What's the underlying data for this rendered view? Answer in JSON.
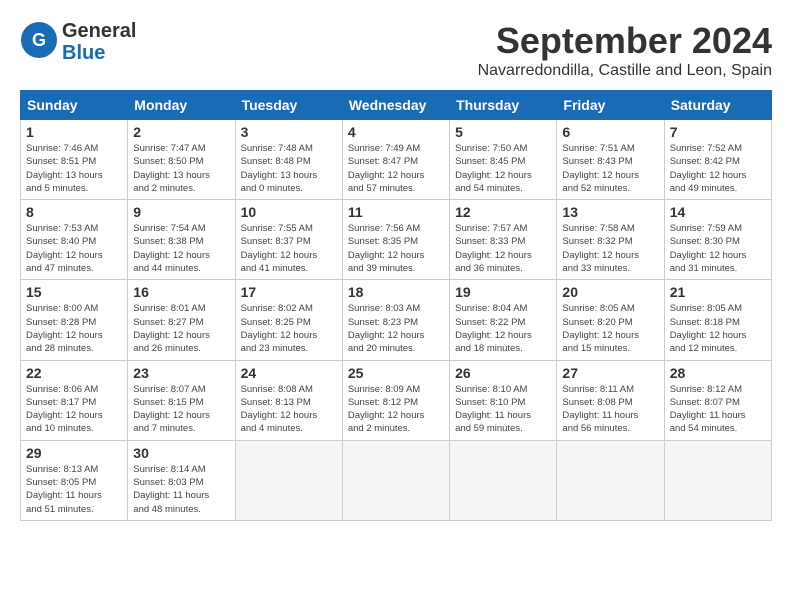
{
  "header": {
    "logo_line1": "General",
    "logo_line2": "Blue",
    "month": "September 2024",
    "location": "Navarredondilla, Castille and Leon, Spain"
  },
  "weekdays": [
    "Sunday",
    "Monday",
    "Tuesday",
    "Wednesday",
    "Thursday",
    "Friday",
    "Saturday"
  ],
  "weeks": [
    [
      {
        "day": "1",
        "info": "Sunrise: 7:46 AM\nSunset: 8:51 PM\nDaylight: 13 hours\nand 5 minutes."
      },
      {
        "day": "2",
        "info": "Sunrise: 7:47 AM\nSunset: 8:50 PM\nDaylight: 13 hours\nand 2 minutes."
      },
      {
        "day": "3",
        "info": "Sunrise: 7:48 AM\nSunset: 8:48 PM\nDaylight: 13 hours\nand 0 minutes."
      },
      {
        "day": "4",
        "info": "Sunrise: 7:49 AM\nSunset: 8:47 PM\nDaylight: 12 hours\nand 57 minutes."
      },
      {
        "day": "5",
        "info": "Sunrise: 7:50 AM\nSunset: 8:45 PM\nDaylight: 12 hours\nand 54 minutes."
      },
      {
        "day": "6",
        "info": "Sunrise: 7:51 AM\nSunset: 8:43 PM\nDaylight: 12 hours\nand 52 minutes."
      },
      {
        "day": "7",
        "info": "Sunrise: 7:52 AM\nSunset: 8:42 PM\nDaylight: 12 hours\nand 49 minutes."
      }
    ],
    [
      {
        "day": "8",
        "info": "Sunrise: 7:53 AM\nSunset: 8:40 PM\nDaylight: 12 hours\nand 47 minutes."
      },
      {
        "day": "9",
        "info": "Sunrise: 7:54 AM\nSunset: 8:38 PM\nDaylight: 12 hours\nand 44 minutes."
      },
      {
        "day": "10",
        "info": "Sunrise: 7:55 AM\nSunset: 8:37 PM\nDaylight: 12 hours\nand 41 minutes."
      },
      {
        "day": "11",
        "info": "Sunrise: 7:56 AM\nSunset: 8:35 PM\nDaylight: 12 hours\nand 39 minutes."
      },
      {
        "day": "12",
        "info": "Sunrise: 7:57 AM\nSunset: 8:33 PM\nDaylight: 12 hours\nand 36 minutes."
      },
      {
        "day": "13",
        "info": "Sunrise: 7:58 AM\nSunset: 8:32 PM\nDaylight: 12 hours\nand 33 minutes."
      },
      {
        "day": "14",
        "info": "Sunrise: 7:59 AM\nSunset: 8:30 PM\nDaylight: 12 hours\nand 31 minutes."
      }
    ],
    [
      {
        "day": "15",
        "info": "Sunrise: 8:00 AM\nSunset: 8:28 PM\nDaylight: 12 hours\nand 28 minutes."
      },
      {
        "day": "16",
        "info": "Sunrise: 8:01 AM\nSunset: 8:27 PM\nDaylight: 12 hours\nand 26 minutes."
      },
      {
        "day": "17",
        "info": "Sunrise: 8:02 AM\nSunset: 8:25 PM\nDaylight: 12 hours\nand 23 minutes."
      },
      {
        "day": "18",
        "info": "Sunrise: 8:03 AM\nSunset: 8:23 PM\nDaylight: 12 hours\nand 20 minutes."
      },
      {
        "day": "19",
        "info": "Sunrise: 8:04 AM\nSunset: 8:22 PM\nDaylight: 12 hours\nand 18 minutes."
      },
      {
        "day": "20",
        "info": "Sunrise: 8:05 AM\nSunset: 8:20 PM\nDaylight: 12 hours\nand 15 minutes."
      },
      {
        "day": "21",
        "info": "Sunrise: 8:05 AM\nSunset: 8:18 PM\nDaylight: 12 hours\nand 12 minutes."
      }
    ],
    [
      {
        "day": "22",
        "info": "Sunrise: 8:06 AM\nSunset: 8:17 PM\nDaylight: 12 hours\nand 10 minutes."
      },
      {
        "day": "23",
        "info": "Sunrise: 8:07 AM\nSunset: 8:15 PM\nDaylight: 12 hours\nand 7 minutes."
      },
      {
        "day": "24",
        "info": "Sunrise: 8:08 AM\nSunset: 8:13 PM\nDaylight: 12 hours\nand 4 minutes."
      },
      {
        "day": "25",
        "info": "Sunrise: 8:09 AM\nSunset: 8:12 PM\nDaylight: 12 hours\nand 2 minutes."
      },
      {
        "day": "26",
        "info": "Sunrise: 8:10 AM\nSunset: 8:10 PM\nDaylight: 11 hours\nand 59 minutes."
      },
      {
        "day": "27",
        "info": "Sunrise: 8:11 AM\nSunset: 8:08 PM\nDaylight: 11 hours\nand 56 minutes."
      },
      {
        "day": "28",
        "info": "Sunrise: 8:12 AM\nSunset: 8:07 PM\nDaylight: 11 hours\nand 54 minutes."
      }
    ],
    [
      {
        "day": "29",
        "info": "Sunrise: 8:13 AM\nSunset: 8:05 PM\nDaylight: 11 hours\nand 51 minutes."
      },
      {
        "day": "30",
        "info": "Sunrise: 8:14 AM\nSunset: 8:03 PM\nDaylight: 11 hours\nand 48 minutes."
      },
      {
        "day": "",
        "info": ""
      },
      {
        "day": "",
        "info": ""
      },
      {
        "day": "",
        "info": ""
      },
      {
        "day": "",
        "info": ""
      },
      {
        "day": "",
        "info": ""
      }
    ]
  ]
}
